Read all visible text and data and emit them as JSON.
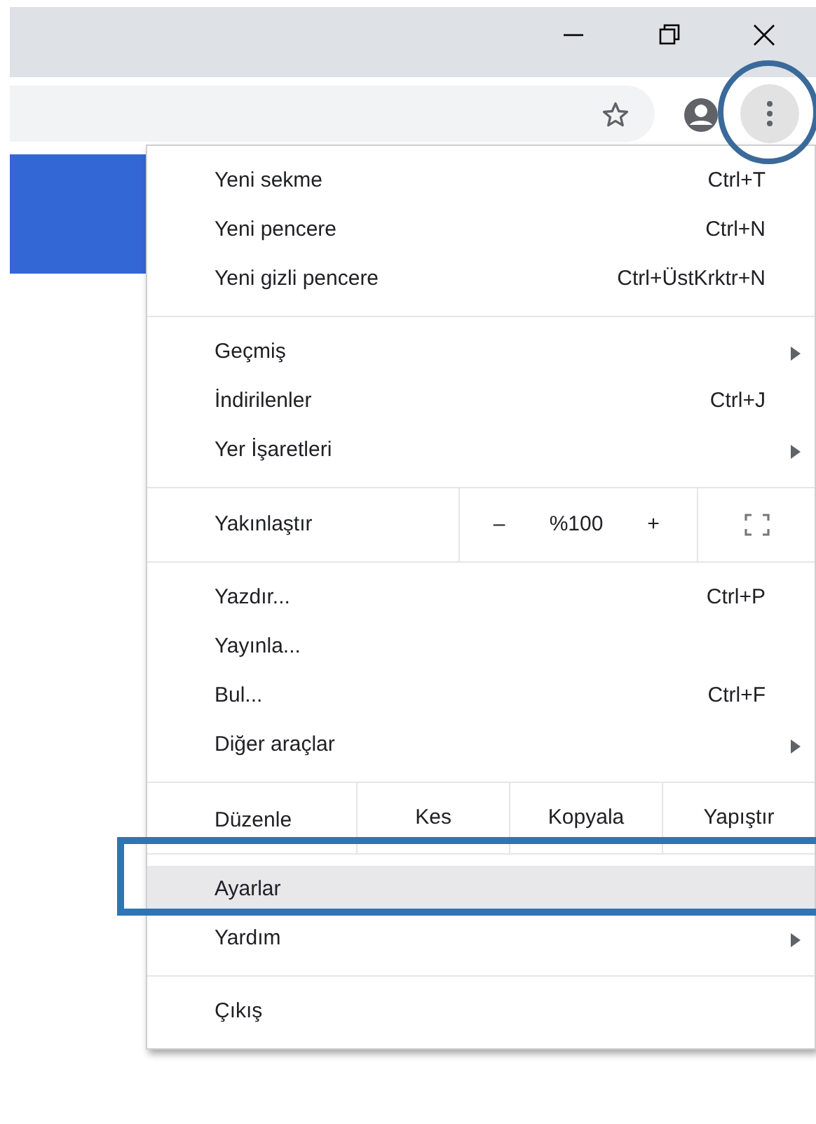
{
  "menu": {
    "sections": [
      {
        "kind": "items",
        "items": [
          {
            "label": "Yeni sekme",
            "shortcut": "Ctrl+T",
            "submenu": false,
            "highlighted": false
          },
          {
            "label": "Yeni pencere",
            "shortcut": "Ctrl+N",
            "submenu": false,
            "highlighted": false
          },
          {
            "label": "Yeni gizli pencere",
            "shortcut": "Ctrl+ÜstKrktr+N",
            "submenu": false,
            "highlighted": false
          }
        ]
      },
      {
        "kind": "items",
        "items": [
          {
            "label": "Geçmiş",
            "submenu": true,
            "highlighted": false
          },
          {
            "label": "İndirilenler",
            "shortcut": "Ctrl+J",
            "submenu": false,
            "highlighted": false
          },
          {
            "label": "Yer İşaretleri",
            "submenu": true,
            "highlighted": false
          }
        ]
      },
      {
        "kind": "zoom",
        "label": "Yakınlaştır",
        "minus": "–",
        "value": "%100",
        "plus": "+"
      },
      {
        "kind": "items",
        "items": [
          {
            "label": "Yazdır...",
            "shortcut": "Ctrl+P",
            "submenu": false,
            "highlighted": false
          },
          {
            "label": "Yayınla...",
            "submenu": false,
            "highlighted": false
          },
          {
            "label": "Bul...",
            "shortcut": "Ctrl+F",
            "submenu": false,
            "highlighted": false
          },
          {
            "label": "Diğer araçlar",
            "submenu": true,
            "highlighted": false
          }
        ]
      },
      {
        "kind": "edit",
        "label": "Düzenle",
        "buttons": [
          "Kes",
          "Kopyala",
          "Yapıştır"
        ]
      },
      {
        "kind": "items",
        "items": [
          {
            "label": "Ayarlar",
            "submenu": false,
            "highlighted": true
          },
          {
            "label": "Yardım",
            "submenu": true,
            "highlighted": false
          }
        ]
      },
      {
        "kind": "items",
        "items": [
          {
            "label": "Çıkış",
            "submenu": false,
            "highlighted": false
          }
        ]
      }
    ]
  }
}
